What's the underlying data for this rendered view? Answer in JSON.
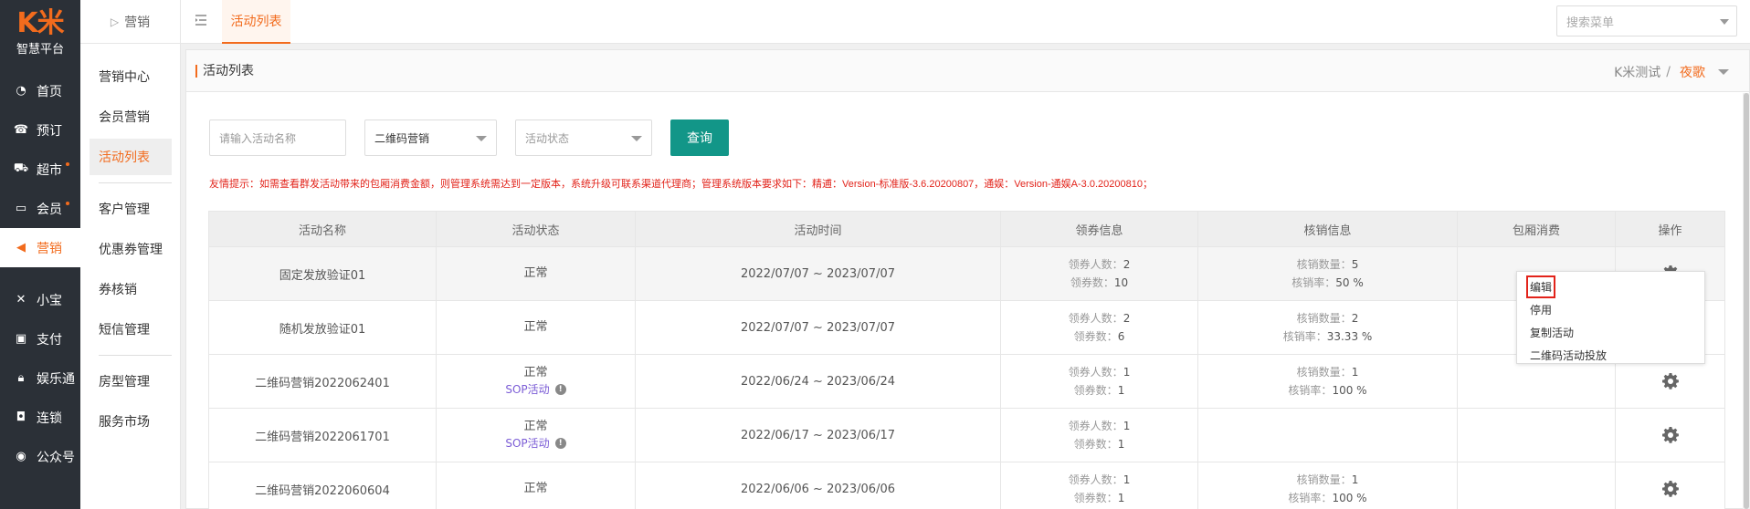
{
  "brand": {
    "logo_mark": "K米",
    "logo_sub": "智慧平台",
    "accent": "#f26b1d"
  },
  "main_nav": [
    {
      "label": "首页",
      "icon": "dashboard-icon",
      "active": false,
      "dot": false
    },
    {
      "label": "预订",
      "icon": "phone-icon",
      "active": false,
      "dot": false
    },
    {
      "label": "超市",
      "icon": "cart-icon",
      "active": false,
      "dot": true
    },
    {
      "label": "会员",
      "icon": "card-icon",
      "active": false,
      "dot": true
    },
    {
      "label": "营销",
      "icon": "megaphone-icon",
      "active": true,
      "dot": false
    },
    {
      "label": "小宝",
      "icon": "xiaobao-icon",
      "active": false,
      "dot": false
    },
    {
      "label": "支付",
      "icon": "pay-icon",
      "active": false,
      "dot": false
    },
    {
      "label": "娱乐通",
      "icon": "lock-icon",
      "active": false,
      "dot": false
    },
    {
      "label": "连锁",
      "icon": "bag-icon",
      "active": false,
      "dot": false
    },
    {
      "label": "公众号",
      "icon": "wechat-icon",
      "active": false,
      "dot": false
    }
  ],
  "sub_nav": {
    "header": "营销",
    "group1": [
      "营销中心",
      "会员营销",
      "活动列表"
    ],
    "group2": [
      "客户管理",
      "优惠券管理",
      "券核销",
      "短信管理"
    ],
    "group3": [
      "房型管理",
      "服务市场"
    ],
    "active": "活动列表"
  },
  "topbar": {
    "tab_label": "活动列表",
    "search_placeholder": "搜索菜单"
  },
  "panel": {
    "title": "活动列表",
    "account": "K米测试",
    "separator": "/",
    "shop": "夜歌"
  },
  "filters": {
    "name_placeholder": "请输入活动名称",
    "type_value": "二维码营销",
    "status_placeholder": "活动状态",
    "query_label": "查询",
    "query_color": "#129688"
  },
  "notice": "友情提示：如需查看群发活动带来的包厢消费金额，则管理系统需达到一定版本，系统升级可联系渠道代理商；管理系统版本要求如下：精逋：Version-标准版-3.6.20200807，通娱：Version-通娱A-3.0.20200810；",
  "table": {
    "headers": [
      "活动名称",
      "活动状态",
      "活动时间",
      "领券信息",
      "核销信息",
      "包厢消费",
      "操作"
    ],
    "labels": {
      "receive_people": "领券人数：",
      "receive_count": "领券数：",
      "verify_count": "核销数量：",
      "verify_rate": "核销率：",
      "sop": "SOP活动"
    },
    "rows": [
      {
        "name": "固定发放验证01",
        "status": "正常",
        "sop": false,
        "time": "2022/07/07 ~ 2023/07/07",
        "recv_people": "2",
        "recv_count": "10",
        "verify": true,
        "verify_count": "5",
        "verify_rate": "50 %"
      },
      {
        "name": "随机发放验证01",
        "status": "正常",
        "sop": false,
        "time": "2022/07/07 ~ 2023/07/07",
        "recv_people": "2",
        "recv_count": "6",
        "verify": true,
        "verify_count": "2",
        "verify_rate": "33.33 %"
      },
      {
        "name": "二维码营销2022062401",
        "status": "正常",
        "sop": true,
        "time": "2022/06/24 ~ 2023/06/24",
        "recv_people": "1",
        "recv_count": "1",
        "verify": true,
        "verify_count": "1",
        "verify_rate": "100 %"
      },
      {
        "name": "二维码营销2022061701",
        "status": "正常",
        "sop": true,
        "time": "2022/06/17 ~ 2023/06/17",
        "recv_people": "1",
        "recv_count": "1",
        "verify": false,
        "verify_count": "",
        "verify_rate": ""
      },
      {
        "name": "二维码营销2022060604",
        "status": "正常",
        "sop": false,
        "time": "2022/06/06 ~ 2023/06/06",
        "recv_people": "1",
        "recv_count": "1",
        "verify": true,
        "verify_count": "1",
        "verify_rate": "100 %"
      }
    ]
  },
  "action_menu": {
    "items": [
      "编辑",
      "停用",
      "复制活动",
      "二维码活动投放"
    ],
    "highlighted": "编辑"
  }
}
